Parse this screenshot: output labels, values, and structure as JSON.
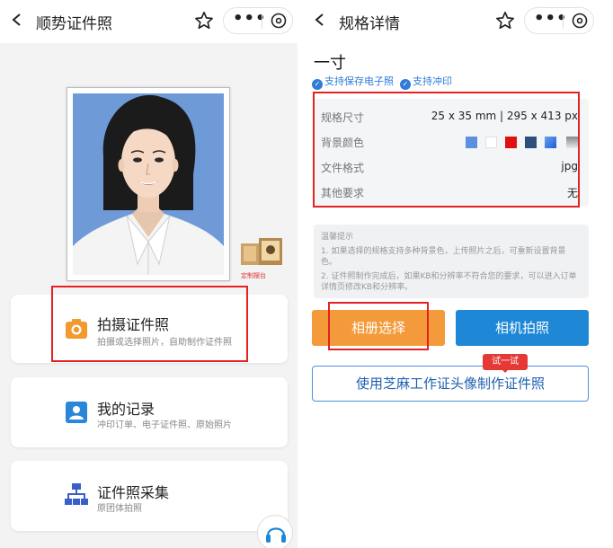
{
  "left": {
    "title": "顺势证件照",
    "thumb_caption": "定制摆台",
    "cards": [
      {
        "title": "拍摄证件照",
        "subtitle": "拍摄或选择照片，自助制作证件照",
        "icon": "camera-icon",
        "color": "#f39a2e"
      },
      {
        "title": "我的记录",
        "subtitle": "冲印订单、电子证件照、原始照片",
        "icon": "user-record-icon",
        "color": "#2a86d8"
      },
      {
        "title": "证件照采集",
        "subtitle": "原团体拍照",
        "icon": "org-chart-icon",
        "color": "#3a5fc8"
      }
    ]
  },
  "right": {
    "title": "规格详情",
    "size_name": "一寸",
    "features": [
      "支持保存电子照",
      "支持冲印"
    ],
    "spec": {
      "size_label": "规格尺寸",
      "size_value": "25 x 35 mm | 295 x 413 px",
      "bg_label": "背景颜色",
      "bg_colors": [
        "#5b8fe0",
        "#ffffff",
        "#e01010",
        "#2e4f7c",
        "#2f6fe0",
        "#b8b8b8"
      ],
      "format_label": "文件格式",
      "format_value": "jpg",
      "other_label": "其他要求",
      "other_value": "无"
    },
    "tips": {
      "heading": "温馨提示",
      "items": [
        "1. 如果选择的规格支持多种背景色，上传照片之后，可重新设置背景色。",
        "2. 证件照制作完成后，如果KB和分辨率不符合您的要求，可以进入订单详情页修改KB和分辨率。"
      ]
    },
    "album_button": "相册选择",
    "camera_button": "相机拍照",
    "zhima_button": "使用芝麻工作证头像制作证件照",
    "badge": "试一试"
  },
  "colors": {
    "highlight": "#e52222",
    "accent_blue": "#1e88d6",
    "accent_orange": "#f39a3a"
  }
}
